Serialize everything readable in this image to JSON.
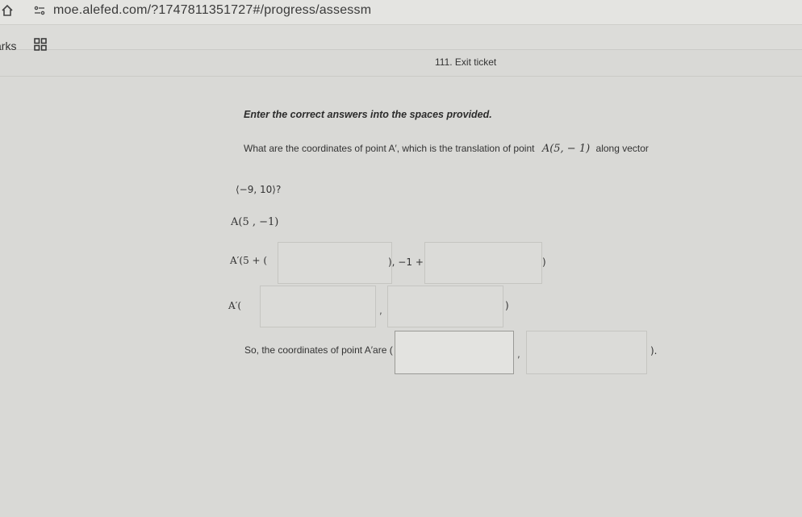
{
  "browser": {
    "url": "moe.alefed.com/?1747811351727#/progress/assessm",
    "home_icon": "home-icon",
    "site_icon": "site-settings-icon"
  },
  "bookmarks": {
    "label": "arks",
    "apps_icon": "apps-grid-icon"
  },
  "page": {
    "title": "111. Exit ticket"
  },
  "problem": {
    "instruction": "Enter the correct answers into the spaces provided.",
    "question_text": "What are the coordinates of point A′, which is the translation of point",
    "point": "A(5, − 1)",
    "question_suffix": "along vector",
    "vector": "⟨−9, 10⟩?",
    "step1": "A(5 , −1)",
    "step2_lead": "A′(5 + (",
    "step2_mid": "), −1 +",
    "step2_end": ")",
    "step3_lead": "A′(",
    "step3_comma": ",",
    "step3_end": ")",
    "final_lead": "So, the coordinates of point A′are (",
    "final_comma": ",",
    "final_end": ").",
    "answers": {
      "step2_x": "",
      "step2_y": "",
      "step3_x": "",
      "step3_y": "",
      "final_x": "",
      "final_y": ""
    }
  }
}
